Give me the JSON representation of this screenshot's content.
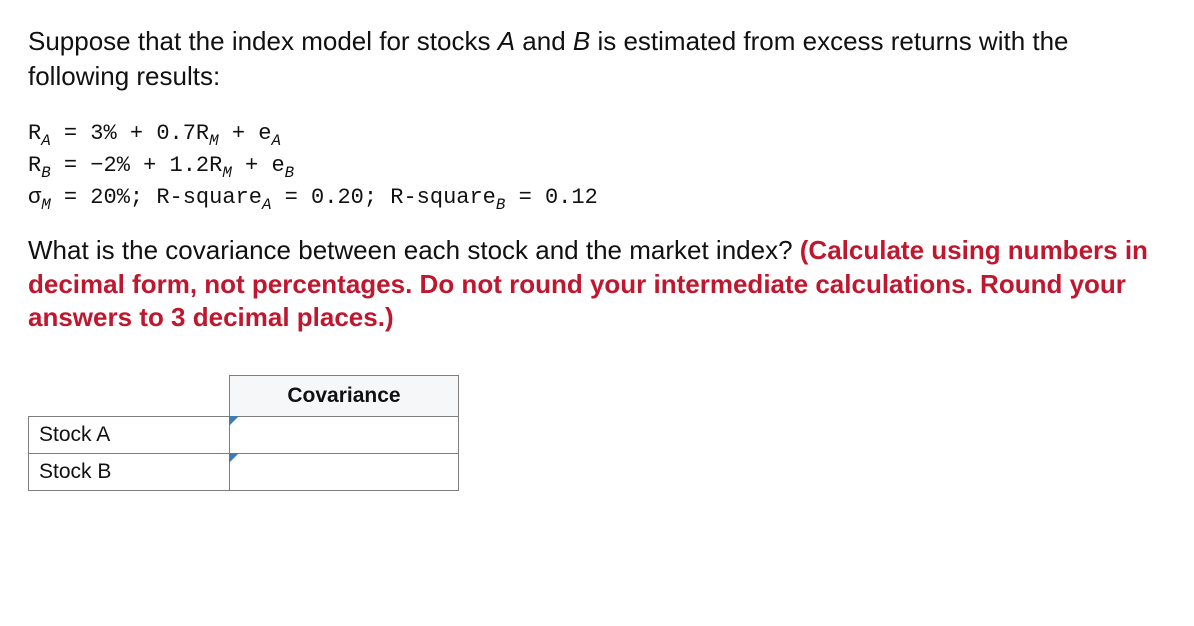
{
  "intro": {
    "prefix": "Suppose that the index model for stocks ",
    "stockA": "A",
    "mid1": " and ",
    "stockB": "B",
    "suffix": " is estimated from excess returns with the following results:"
  },
  "eq": {
    "line1": {
      "lhs": "R",
      "sub1": "A",
      "p1": " = 3% + 0.7R",
      "sub2": "M",
      "p2": " + e",
      "sub3": "A"
    },
    "line2": {
      "lhs": "R",
      "sub1": "B",
      "p1": " = −2% + 1.2R",
      "sub2": "M",
      "p2": " + e",
      "sub3": "B"
    },
    "line3": {
      "lhs": "σ",
      "sub1": "M",
      "p1": " = 20%; R-square",
      "sub2": "A",
      "p2": " = 0.20; R-square",
      "sub3": "B",
      "p3": " = 0.12"
    }
  },
  "question": {
    "text": "What is the covariance between each stock and the market index? ",
    "instruction": "(Calculate using numbers in decimal form, not percentages. Do not round your intermediate calculations. Round your answers to 3 decimal places.)"
  },
  "table": {
    "header": "Covariance",
    "rows": [
      {
        "label": "Stock A",
        "value": ""
      },
      {
        "label": "Stock B",
        "value": ""
      }
    ]
  }
}
